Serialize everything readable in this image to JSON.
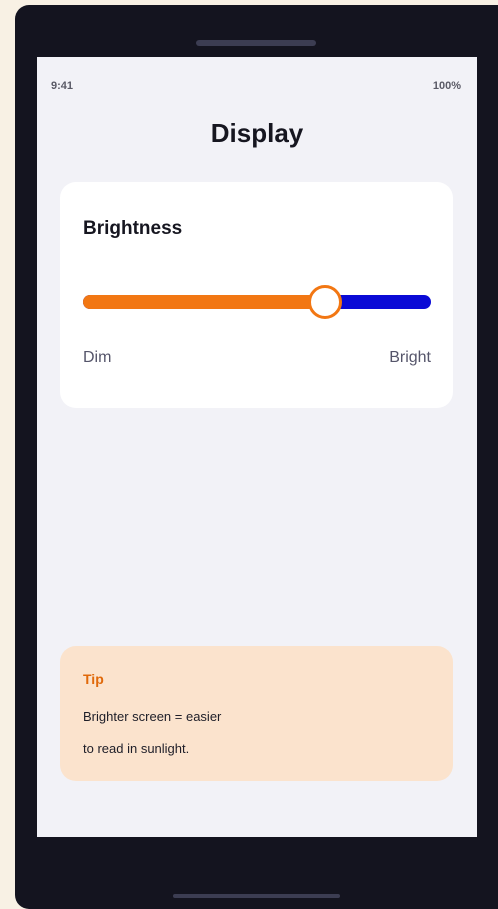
{
  "status_bar": {
    "time": "9:41",
    "battery": "100%"
  },
  "page": {
    "title": "Display"
  },
  "brightness": {
    "title": "Brightness",
    "value_fraction": 0.695,
    "min_label": "Dim",
    "max_label": "Bright",
    "fill_color": "#f27713",
    "track_color": "#0a0ad6"
  },
  "tip": {
    "title": "Tip",
    "lines": [
      "Brighter screen = easier",
      "to read in sunlight."
    ],
    "background_color": "#fbe3cd",
    "title_color": "#e0690a"
  }
}
